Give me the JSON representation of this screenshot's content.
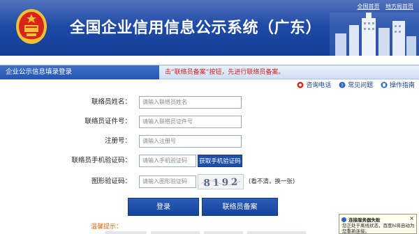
{
  "header": {
    "title": "全国企业信用信息公示系统（广东）",
    "links": [
      "全国首页",
      "地方局首页"
    ]
  },
  "panel": {
    "tab_title": "企业公示信息填录登录",
    "notice": "击“联络员备案”按钮，先进行联络员备案。",
    "help": [
      {
        "label": "咨询电话",
        "icon": "phone-icon"
      },
      {
        "label": "常见问题",
        "icon": "question-icon"
      },
      {
        "label": "操作指南",
        "icon": "guide-icon"
      }
    ]
  },
  "form": {
    "name_label": "联络员姓名：",
    "name_placeholder": "请输入联络员姓名",
    "id_label": "联络员证件号：",
    "id_placeholder": "请输入联络员证件号",
    "reg_label": "注册号：",
    "reg_placeholder": "请输入注册号",
    "sms_label": "联络员手机验证码：",
    "sms_placeholder": "请输入手机验证码",
    "sms_button": "获取手机验证码",
    "captcha_label": "图形验证码：",
    "captcha_placeholder": "请输入图形验证码",
    "captcha_text": "8192",
    "captcha_refresh": "(看不清，换一张)",
    "login_button": "登录",
    "contact_button": "联络员备案"
  },
  "tips": {
    "title": "温馨提示："
  },
  "toast": {
    "title": "连接服务器失败",
    "close": "×",
    "body": "您正处于离线状态，百度hi将自动为您重新连接。"
  },
  "colors": {
    "header_blue": "#1f4aa6",
    "button_blue": "#1e4fa8",
    "notice_red": "#d42020",
    "tip_orange": "#d86a10"
  }
}
